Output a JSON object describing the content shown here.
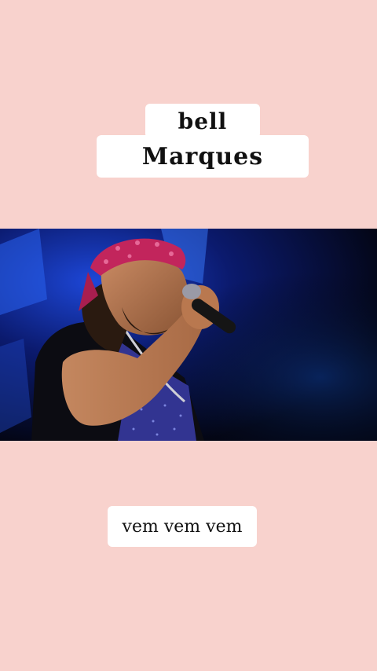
{
  "title": {
    "line1": "bell",
    "line2": "Marques"
  },
  "video": {
    "subject": "singer-performing"
  },
  "caption": {
    "text": "vem vem vem"
  },
  "colors": {
    "background": "#f8d2cd",
    "label_bg": "#ffffff",
    "text": "#111111",
    "bandana": "#c2255c",
    "stage_light": "#1e4fd6"
  }
}
